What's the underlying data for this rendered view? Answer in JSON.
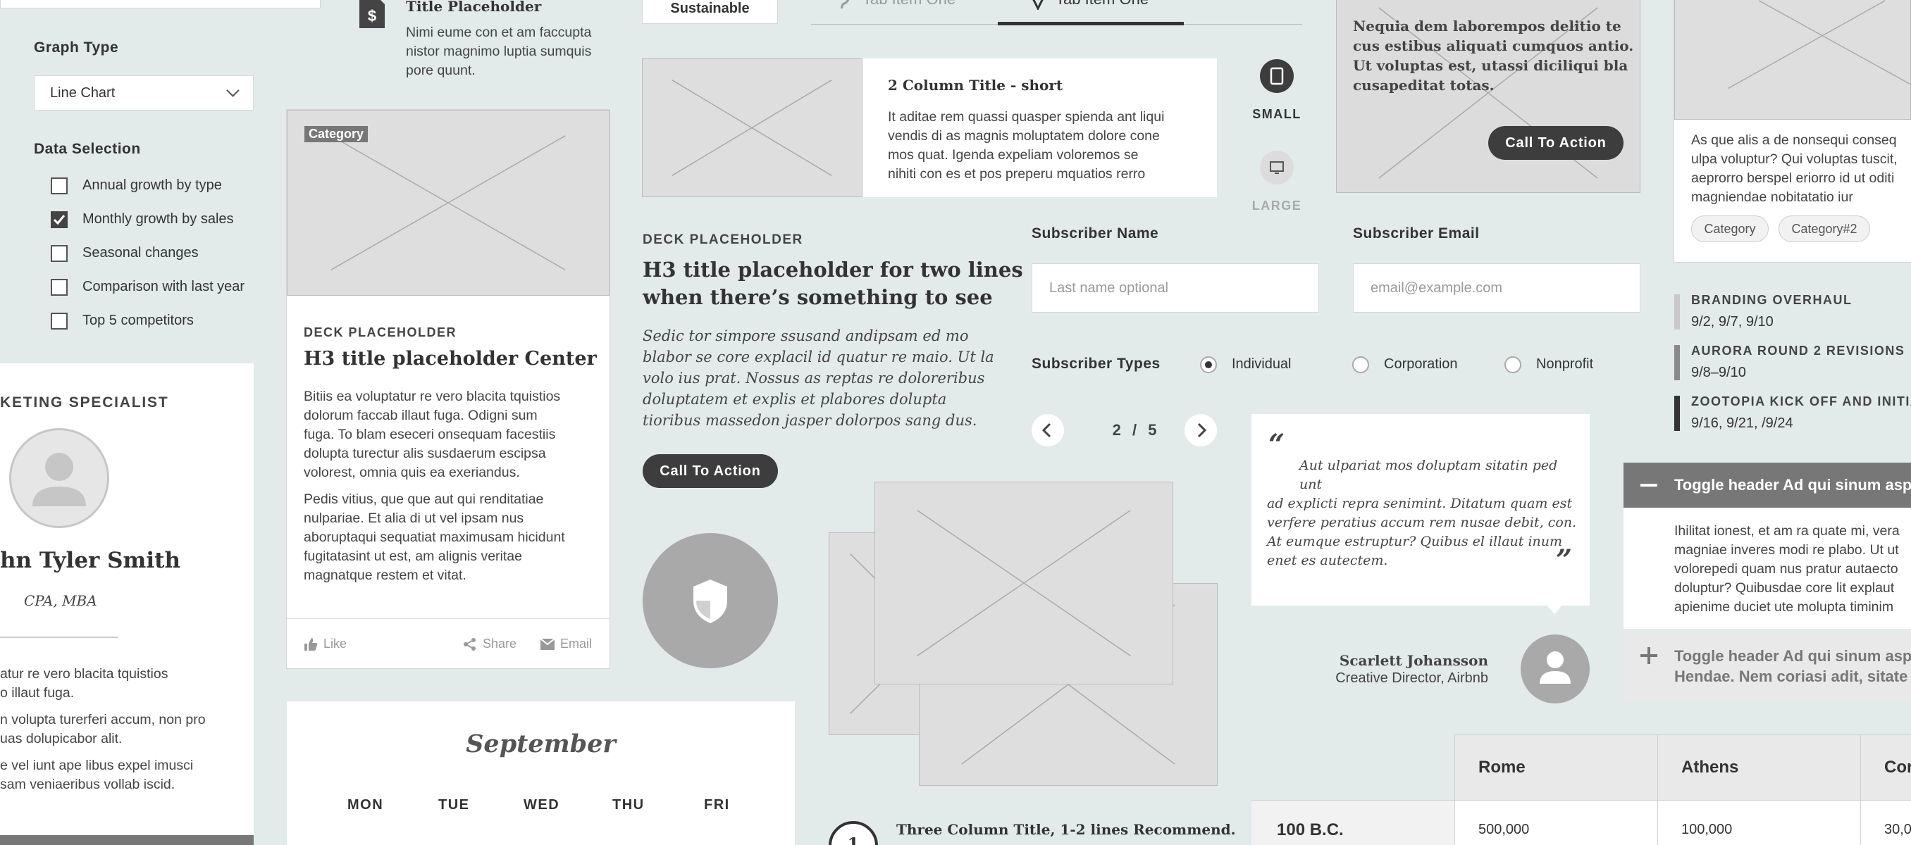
{
  "filters": {
    "graph_type_label": "Graph Type",
    "graph_type_value": "Line Chart",
    "data_selection_label": "Data Selection",
    "options": [
      {
        "label": "Annual growth by type",
        "checked": false
      },
      {
        "label": "Monthly growth by sales",
        "checked": true
      },
      {
        "label": "Seasonal changes",
        "checked": false
      },
      {
        "label": "Comparison with last year",
        "checked": false
      },
      {
        "label": "Top 5 competitors",
        "checked": false
      }
    ]
  },
  "profile": {
    "role": "KETING SPECIALIST",
    "name": "hn Tyler Smith",
    "credentials": "CPA, MBA",
    "p1a": "atur re vero blacita tquistios",
    "p1b": "o illaut fuga.",
    "p2a": "n volupta turerferi accum, non pro",
    "p2b": "uas dolupicabor alit.",
    "p3a": "e vel iunt ape libus expel imusci",
    "p3b": "sam veniaeribus vollab iscid."
  },
  "icon_item": {
    "title": "Title Placeholder",
    "text_lines": [
      "Nimi eume con et am faccupta",
      "nistor magnimo luptia sumquis",
      "pore quunt."
    ]
  },
  "card": {
    "category": "Category",
    "deck": "DECK PLACEHOLDER",
    "title": "H3 title placeholder Center",
    "p1_lines": [
      "Bitiis ea voluptatur re vero blacita tquistios",
      "dolorum faccab illaut fuga. Odigni sum",
      "fuga. To blam eseceri onsequam facestiis",
      "dolupta turectur alis susdaerum escipsa",
      "volorest, omnia quis ea exeriandus."
    ],
    "p2_lines": [
      "Pedis vitius, que que aut qui renditatiae",
      "nulpariae. Et alia di ut vel ipsam nus",
      "aboruptaqui sequatiat maximusam hicidunt",
      "fugitatasint ut est, am alignis veritae",
      "magnatque restem et vitat."
    ],
    "like": "Like",
    "share": "Share",
    "email": "Email"
  },
  "calendar": {
    "month": "September",
    "days": [
      "MON",
      "TUE",
      "WED",
      "THU",
      "FRI"
    ]
  },
  "tabs": {
    "sustainable": "Sustainable",
    "tab1": "Tab Item One",
    "tab2": "Tab Item One"
  },
  "two_col": {
    "title": "2 Column Title - short",
    "lines": [
      "It aditae rem quassi quasper spienda ant liqui",
      "vendis di as magnis moluptatem dolore cone",
      "mos quat. Igenda expeliam voloremos se",
      "nihiti con es et pos preperu mquatios rerro"
    ]
  },
  "deck_block": {
    "deck": "DECK PLACEHOLDER",
    "title_lines": [
      "H3 title placeholder for two lines",
      "when there’s something to see"
    ],
    "italic_lines": [
      "Sedic tor simpore ssusand andipsam ed mo",
      "blabor se core explacil id quatur re maio. Ut la",
      "volo ius prat. Nossus as reptas re doloreribus",
      "doluptatem et explis et plabores dolupta",
      "tioribus massedon jasper dolorpos sang dus."
    ],
    "cta": "Call To Action"
  },
  "devices": {
    "small": "SMALL",
    "large": "LARGE"
  },
  "subscribe": {
    "name_label": "Subscriber Name",
    "name_placeholder": "Last name optional",
    "email_label": "Subscriber Email",
    "email_placeholder": "email@example.com",
    "types_label": "Subscriber Types",
    "types": [
      {
        "label": "Individual",
        "selected": true
      },
      {
        "label": "Corporation",
        "selected": false
      },
      {
        "label": "Nonprofit",
        "selected": false
      }
    ]
  },
  "pager": {
    "current": "2",
    "sep": "/",
    "total": "5"
  },
  "quote": {
    "open": "“",
    "close": "”",
    "lines": [
      "Aut ulpariat mos doluptam sitatin ped unt",
      "ad explicti repra senimint. Ditatum quam est",
      "verfere peratius accum rem nusae debit, con.",
      "At eumque estruptur? Quibus el illaut inum",
      "enet es autectem."
    ],
    "author": "Scarlett Johansson",
    "author_role": "Creative Director, Airbnb"
  },
  "three_col": {
    "number": "1",
    "title": "Three Column Title, 1-2 lines Recommend."
  },
  "overlay": {
    "lines": [
      "Nequia dem laborempos delitio te",
      "cus estibus aliquati cumquos antio.",
      "Ut voluptas est, utassi diciliqui bla",
      "cusapeditat totas."
    ],
    "cta": "Call To Action"
  },
  "right_card": {
    "lines": [
      "As que alis a de nonsequi conseq",
      "ulpa voluptur? Qui voluptas tuscit,",
      "aeprorro berspel eriorro id ut oditi",
      "magniendae nobitatatio iur"
    ],
    "tags": [
      "Category",
      "Category#2"
    ]
  },
  "timeline": [
    {
      "title": "BRANDING OVERHAUL",
      "dates": "9/2, 9/7, 9/10",
      "color": "#c9c9c9"
    },
    {
      "title": "AURORA ROUND 2 REVISIONS",
      "dates": "9/8–9/10",
      "color": "#8a8a8a"
    },
    {
      "title": "ZOOTOPIA KICK OFF AND INITIAL",
      "dates": "9/16, 9/21, /9/24",
      "color": "#333333"
    }
  ],
  "accordion": {
    "open_title": "Toggle header Ad qui sinum asp",
    "open_lines": [
      "Ihilitat ionest, et am ra quate mi, vera",
      "magniae inveres modi re plabo. Ut ut",
      "volorepedi quam nus pratur autaecto",
      "doluptur? Quibusdae core lit explaut",
      "apienime duciet ute molupta timinim"
    ],
    "closed_line1": "Toggle header Ad qui sinum asp",
    "closed_line2": "Hendae. Nem coriasi adit, sitate"
  },
  "table": {
    "headers": [
      "Rome",
      "Athens",
      "Cor"
    ],
    "row_label": "100 B.C.",
    "row": [
      "500,000",
      "100,000",
      "30,0"
    ]
  }
}
